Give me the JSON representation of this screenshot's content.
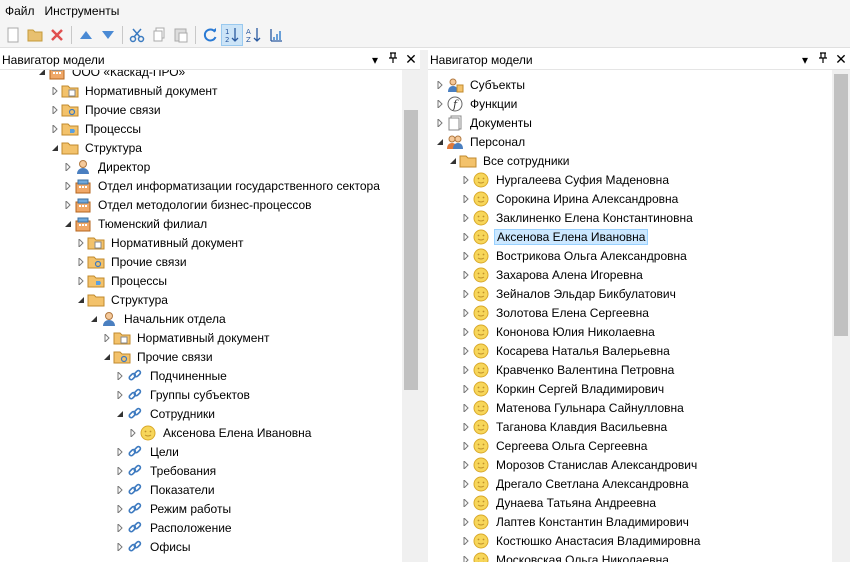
{
  "menu": [
    "Файл",
    "Инструменты"
  ],
  "toolbar_icons": [
    "new-icon",
    "open-folder-icon",
    "delete-icon",
    "move-up-icon",
    "move-down-icon",
    "cut-icon",
    "copy-icon",
    "paste-icon",
    "refresh-icon",
    "sort-numeric-icon",
    "sort-alpha-icon",
    "sort-custom-icon"
  ],
  "left_panel": {
    "title": "Навигатор модели",
    "items": [
      {
        "label": "ООО «Каскад-ПРО»",
        "level": 2,
        "icon": "building-icon",
        "expanded": true
      },
      {
        "label": "Нормативный документ",
        "level": 3,
        "icon": "folder-doc-icon",
        "expanded": false
      },
      {
        "label": "Прочие связи",
        "level": 3,
        "icon": "folder-link-icon",
        "expanded": false
      },
      {
        "label": "Процессы",
        "level": 3,
        "icon": "folder-process-icon",
        "expanded": false
      },
      {
        "label": "Структура",
        "level": 3,
        "icon": "folder-icon",
        "expanded": true
      },
      {
        "label": "Директор",
        "level": 4,
        "icon": "person-icon",
        "expanded": false
      },
      {
        "label": "Отдел информатизации государственного сектора",
        "level": 4,
        "icon": "building-icon",
        "expanded": false
      },
      {
        "label": "Отдел методологии бизнес-процессов",
        "level": 4,
        "icon": "building-icon",
        "expanded": false
      },
      {
        "label": "Тюменский филиал",
        "level": 4,
        "icon": "building-icon",
        "expanded": true
      },
      {
        "label": "Нормативный документ",
        "level": 5,
        "icon": "folder-doc-icon",
        "expanded": false
      },
      {
        "label": "Прочие связи",
        "level": 5,
        "icon": "folder-link-icon",
        "expanded": false
      },
      {
        "label": "Процессы",
        "level": 5,
        "icon": "folder-process-icon",
        "expanded": false
      },
      {
        "label": "Структура",
        "level": 5,
        "icon": "folder-icon",
        "expanded": true
      },
      {
        "label": "Начальник отдела",
        "level": 6,
        "icon": "person-icon",
        "expanded": true
      },
      {
        "label": "Нормативный документ",
        "level": 7,
        "icon": "folder-doc-icon",
        "expanded": false
      },
      {
        "label": "Прочие связи",
        "level": 7,
        "icon": "folder-link-icon",
        "expanded": true
      },
      {
        "label": "Подчиненные",
        "level": 8,
        "icon": "link-icon",
        "expanded": false
      },
      {
        "label": "Группы субъектов",
        "level": 8,
        "icon": "link-icon",
        "expanded": false
      },
      {
        "label": "Сотрудники",
        "level": 8,
        "icon": "link-icon",
        "expanded": true
      },
      {
        "label": "Аксенова Елена Ивановна",
        "level": 9,
        "icon": "smiley-icon",
        "expanded": false
      },
      {
        "label": "Цели",
        "level": 8,
        "icon": "link-icon",
        "expanded": false
      },
      {
        "label": "Требования",
        "level": 8,
        "icon": "link-icon",
        "expanded": false
      },
      {
        "label": "Показатели",
        "level": 8,
        "icon": "link-icon",
        "expanded": false
      },
      {
        "label": "Режим работы",
        "level": 8,
        "icon": "link-icon",
        "expanded": false
      },
      {
        "label": "Расположение",
        "level": 8,
        "icon": "link-icon",
        "expanded": false
      },
      {
        "label": "Офисы",
        "level": 8,
        "icon": "link-icon",
        "expanded": false
      }
    ]
  },
  "right_panel": {
    "title": "Навигатор модели",
    "items": [
      {
        "label": "Субъекты",
        "level": 0,
        "icon": "subjects-icon",
        "expanded": false
      },
      {
        "label": "Функции",
        "level": 0,
        "icon": "function-icon",
        "expanded": false
      },
      {
        "label": "Документы",
        "level": 0,
        "icon": "documents-icon",
        "expanded": false
      },
      {
        "label": "Персонал",
        "level": 0,
        "icon": "staff-icon",
        "expanded": true
      },
      {
        "label": "Все сотрудники",
        "level": 1,
        "icon": "folder-icon",
        "expanded": true
      },
      {
        "label": "Нургалеева Суфия Маденовна",
        "level": 2,
        "icon": "smiley-icon",
        "expanded": false
      },
      {
        "label": "Сорокина Ирина Александровна",
        "level": 2,
        "icon": "smiley-icon",
        "expanded": false
      },
      {
        "label": "Заклиненко Елена Константиновна",
        "level": 2,
        "icon": "smiley-icon",
        "expanded": false
      },
      {
        "label": "Аксенова Елена Ивановна",
        "level": 2,
        "icon": "smiley-icon",
        "expanded": false,
        "selected": true
      },
      {
        "label": "Вострикова Ольга Александровна",
        "level": 2,
        "icon": "smiley-icon",
        "expanded": false
      },
      {
        "label": "Захарова Алена Игоревна",
        "level": 2,
        "icon": "smiley-icon",
        "expanded": false
      },
      {
        "label": "Зейналов Эльдар Бикбулатович",
        "level": 2,
        "icon": "smiley-icon",
        "expanded": false
      },
      {
        "label": "Золотова Елена Сергеевна",
        "level": 2,
        "icon": "smiley-icon",
        "expanded": false
      },
      {
        "label": "Кононова Юлия Николаевна",
        "level": 2,
        "icon": "smiley-icon",
        "expanded": false
      },
      {
        "label": "Косарева Наталья Валерьевна",
        "level": 2,
        "icon": "smiley-icon",
        "expanded": false
      },
      {
        "label": "Кравченко Валентина Петровна",
        "level": 2,
        "icon": "smiley-icon",
        "expanded": false
      },
      {
        "label": "Коркин Сергей Владимирович",
        "level": 2,
        "icon": "smiley-icon",
        "expanded": false
      },
      {
        "label": "Матенова Гульнара Сайнулловна",
        "level": 2,
        "icon": "smiley-icon",
        "expanded": false
      },
      {
        "label": "Таганова Клавдия Васильевна",
        "level": 2,
        "icon": "smiley-icon",
        "expanded": false
      },
      {
        "label": "Сергеева Ольга Сергеевна",
        "level": 2,
        "icon": "smiley-icon",
        "expanded": false
      },
      {
        "label": "Морозов Станислав Александрович",
        "level": 2,
        "icon": "smiley-icon",
        "expanded": false
      },
      {
        "label": "Дрегало Светлана Александровна",
        "level": 2,
        "icon": "smiley-icon",
        "expanded": false
      },
      {
        "label": "Дунаева Татьяна Андреевна",
        "level": 2,
        "icon": "smiley-icon",
        "expanded": false
      },
      {
        "label": "Лаптев Константин Владимирович",
        "level": 2,
        "icon": "smiley-icon",
        "expanded": false
      },
      {
        "label": "Костюшко Анастасия Владимировна",
        "level": 2,
        "icon": "smiley-icon",
        "expanded": false
      },
      {
        "label": "Московская Ольга Николаевна",
        "level": 2,
        "icon": "smiley-icon",
        "expanded": false
      }
    ]
  }
}
